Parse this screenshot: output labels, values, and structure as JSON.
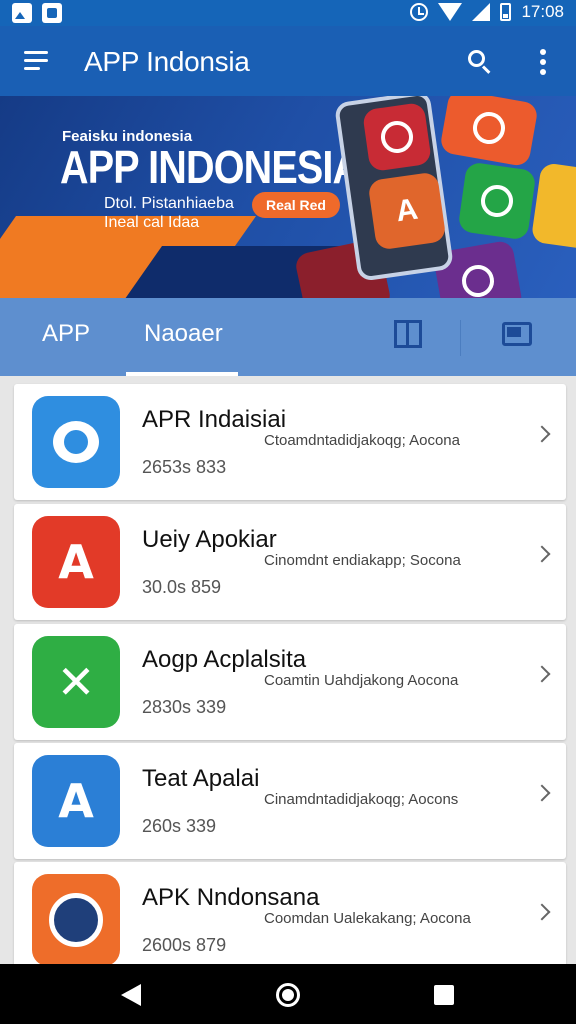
{
  "status_bar": {
    "time": "17:08",
    "icons": [
      "image-icon",
      "app-notification-icon",
      "alarm-icon",
      "wifi-icon",
      "signal-icon",
      "battery-icon"
    ]
  },
  "app_bar": {
    "title": "APP Indonsia",
    "icons": [
      "menu-icon",
      "search-icon",
      "more-vert-icon"
    ]
  },
  "banner": {
    "kicker": "Feaisku indonesia",
    "headline": "APP INDONESIA",
    "subtitle_line1": "Dtol. Pistanhiaeba",
    "subtitle_line2": "Ineal cal Idaa",
    "badge": "Real Red"
  },
  "tabs": {
    "items": [
      {
        "label": "APP",
        "selected": false
      },
      {
        "label": "Naoaer",
        "selected": true
      }
    ],
    "right_icons": [
      "book-map-icon",
      "window-icon"
    ]
  },
  "apps": [
    {
      "name": "APR Indaisiai",
      "description": "Ctoamdntadidjakoqg; Aocona",
      "meta": "2653s 833",
      "icon": "chat-bubble-icon",
      "color": "#2f8ee0"
    },
    {
      "name": "Ueiy Apokiar",
      "description": "Cinomdnt  endiakapp; Socona",
      "meta": "30.0s 859",
      "icon": "letter-a-icon",
      "color": "#e23a28"
    },
    {
      "name": "Aogp Acplalsita",
      "description": "Coamtin Uahdjakong Aocona",
      "meta": "2830s 339",
      "icon": "arrow-compass-icon",
      "color": "#2fae44"
    },
    {
      "name": "Teat Apalai",
      "description": "Cinamdntadidjakoqg; Aocons",
      "meta": "260s 339",
      "icon": "app-store-icon",
      "color": "#2b7fd6"
    },
    {
      "name": "APK Nndonsana",
      "description": "Coomdan Ualekakang; Aocona",
      "meta": "2600s 879",
      "icon": "disc-icon",
      "color": "#ee6d2a"
    }
  ],
  "nav_bar": {
    "icons": [
      "back-icon",
      "home-icon",
      "recents-icon"
    ]
  },
  "colors": {
    "primary": "#1a5fb4",
    "tab_bar": "#5e8fcf",
    "accent_orange": "#f07a22"
  }
}
